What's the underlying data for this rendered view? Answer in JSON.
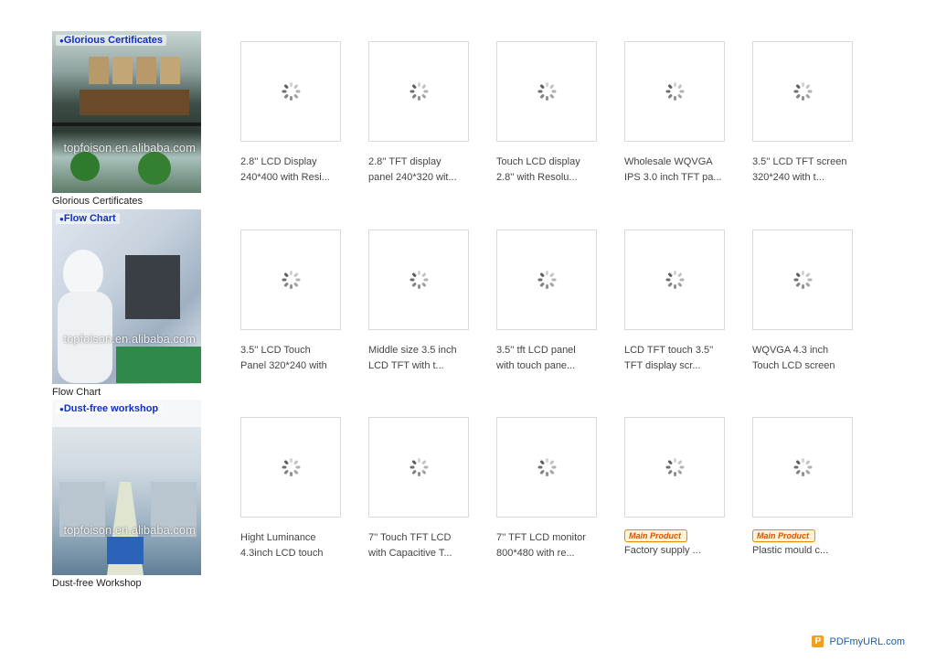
{
  "sidebar": {
    "items": [
      {
        "banner": "Glorious Certificates",
        "watermark": "topfoison.en.alibaba.com",
        "caption": "Glorious Certificates"
      },
      {
        "banner": "Flow Chart",
        "watermark": "topfoison.en.alibaba.com",
        "caption": "Flow Chart"
      },
      {
        "banner": "Dust-free workshop",
        "watermark": "topfoison.en.alibaba.com",
        "caption": "Dust-free Workshop"
      }
    ]
  },
  "products": {
    "row1": [
      {
        "line1": "2.8'' LCD Display",
        "line2": "240*400 with Resi..."
      },
      {
        "line1": "2.8'' TFT display",
        "line2": "panel 240*320 wit..."
      },
      {
        "line1": "Touch LCD display",
        "line2": "2.8'' with Resolu..."
      },
      {
        "line1": "Wholesale WQVGA",
        "line2": "IPS 3.0 inch TFT pa..."
      },
      {
        "line1": "3.5'' LCD TFT screen",
        "line2": "320*240 with t..."
      }
    ],
    "row2": [
      {
        "line1": "3.5'' LCD Touch",
        "line2": "Panel 320*240 with"
      },
      {
        "line1": "Middle size 3.5 inch",
        "line2": "LCD TFT with t..."
      },
      {
        "line1": "3.5'' tft LCD panel",
        "line2": "with touch pane..."
      },
      {
        "line1": "LCD TFT touch 3.5''",
        "line2": "TFT display scr..."
      },
      {
        "line1": "WQVGA 4.3 inch",
        "line2": "Touch LCD screen"
      }
    ],
    "row3": [
      {
        "line1": "Hight Luminance",
        "line2": "4.3inch LCD touch"
      },
      {
        "line1": "7'' Touch TFT LCD",
        "line2": "with Capacitive T..."
      },
      {
        "line1": "7'' TFT LCD monitor",
        "line2": "800*480 with re..."
      }
    ],
    "row3_badged": [
      {
        "badge": "Main Product",
        "title": "Factory supply ..."
      },
      {
        "badge": "Main Product",
        "title": "Plastic mould c..."
      }
    ]
  },
  "footer": {
    "logo": "P",
    "text": "PDFmyURL.com"
  },
  "colors": {
    "accent": "#1a5fa8",
    "badge": "#e68a00",
    "border": "#d9d9d9"
  }
}
